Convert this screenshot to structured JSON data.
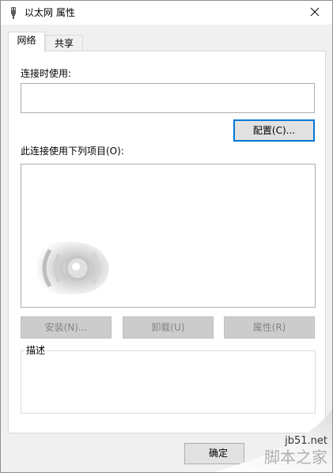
{
  "window": {
    "title": "以太网 属性",
    "close_glyph": "✕",
    "title_icon": "network-adapter-icon",
    "close_icon": "close-icon"
  },
  "tabs": [
    {
      "label": "网络",
      "active": true
    },
    {
      "label": "共享",
      "active": false
    }
  ],
  "connect_using": {
    "label": "连接时使用:",
    "value": ""
  },
  "configure_button": {
    "label": "配置(C)..."
  },
  "components": {
    "label": "此连接使用下列项目(O):",
    "items": [],
    "loading_icon": "loading-spinner-icon"
  },
  "action_buttons": {
    "install": "安装(N)...",
    "uninstall": "卸载(U)",
    "properties": "属性(R)"
  },
  "description": {
    "label": "描述",
    "text": ""
  },
  "footer": {
    "ok_label": "确定"
  },
  "watermark": {
    "site": "jb51.net",
    "logo_text": "脚本之家"
  },
  "colors": {
    "accent": "#0078d7",
    "window_bg": "#f0f0f0",
    "panel_bg": "#ffffff",
    "disabled_text": "#838383"
  }
}
